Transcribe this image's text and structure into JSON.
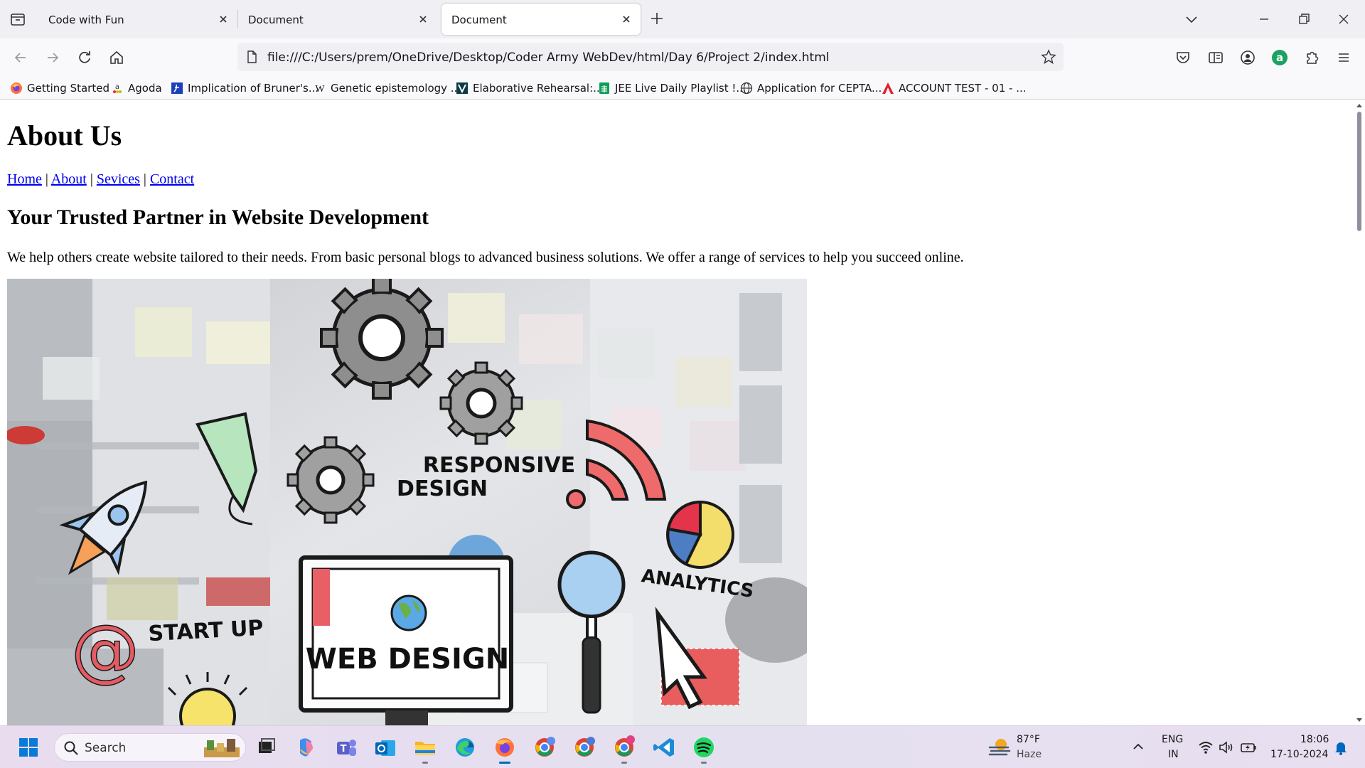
{
  "browser": {
    "tabs": [
      {
        "title": "Code with Fun",
        "active": false
      },
      {
        "title": "Document",
        "active": false
      },
      {
        "title": "Document",
        "active": true
      }
    ],
    "url": "file:///C:/Users/prem/OneDrive/Desktop/Coder Army WebDev/html/Day 6/Project 2/index.html",
    "bookmarks": [
      {
        "label": "Getting Started",
        "icon": "firefox-icon"
      },
      {
        "label": "Agoda",
        "icon": "agoda-icon"
      },
      {
        "label": "Implication of Bruner's...",
        "icon": "document-icon"
      },
      {
        "label": "Genetic epistemology ...",
        "icon": "wikipedia-icon"
      },
      {
        "label": "Elaborative Rehearsal:...",
        "icon": "v-icon"
      },
      {
        "label": "JEE Live Daily Playlist !...",
        "icon": "sheets-icon"
      },
      {
        "label": "Application for CEPTA...",
        "icon": "globe-icon"
      },
      {
        "label": "ACCOUNT TEST - 01 - ...",
        "icon": "a-icon"
      }
    ],
    "accent": "#0060df"
  },
  "page": {
    "heading": "About Us",
    "nav": {
      "home": "Home",
      "about": "About",
      "services": "Sevices",
      "contact": "Contact",
      "sep": "|"
    },
    "subheading": "Your Trusted Partner in Website Development",
    "intro": "We help others create website tailored to their needs. From basic personal blogs to advanced business solutions. We offer a range of services to help you succeed online.",
    "hero_labels": {
      "responsive": "RESPONSIVE",
      "design": "DESIGN",
      "analytics": "ANALYTICS",
      "startup": "START UP",
      "webdesign": "WEB DESIGN",
      "at": "@"
    }
  },
  "taskbar": {
    "search_placeholder": "Search",
    "weather_temp": "87°F",
    "weather_desc": "Haze",
    "lang": "ENG",
    "region": "IN",
    "time": "18:06",
    "date": "17-10-2024"
  }
}
